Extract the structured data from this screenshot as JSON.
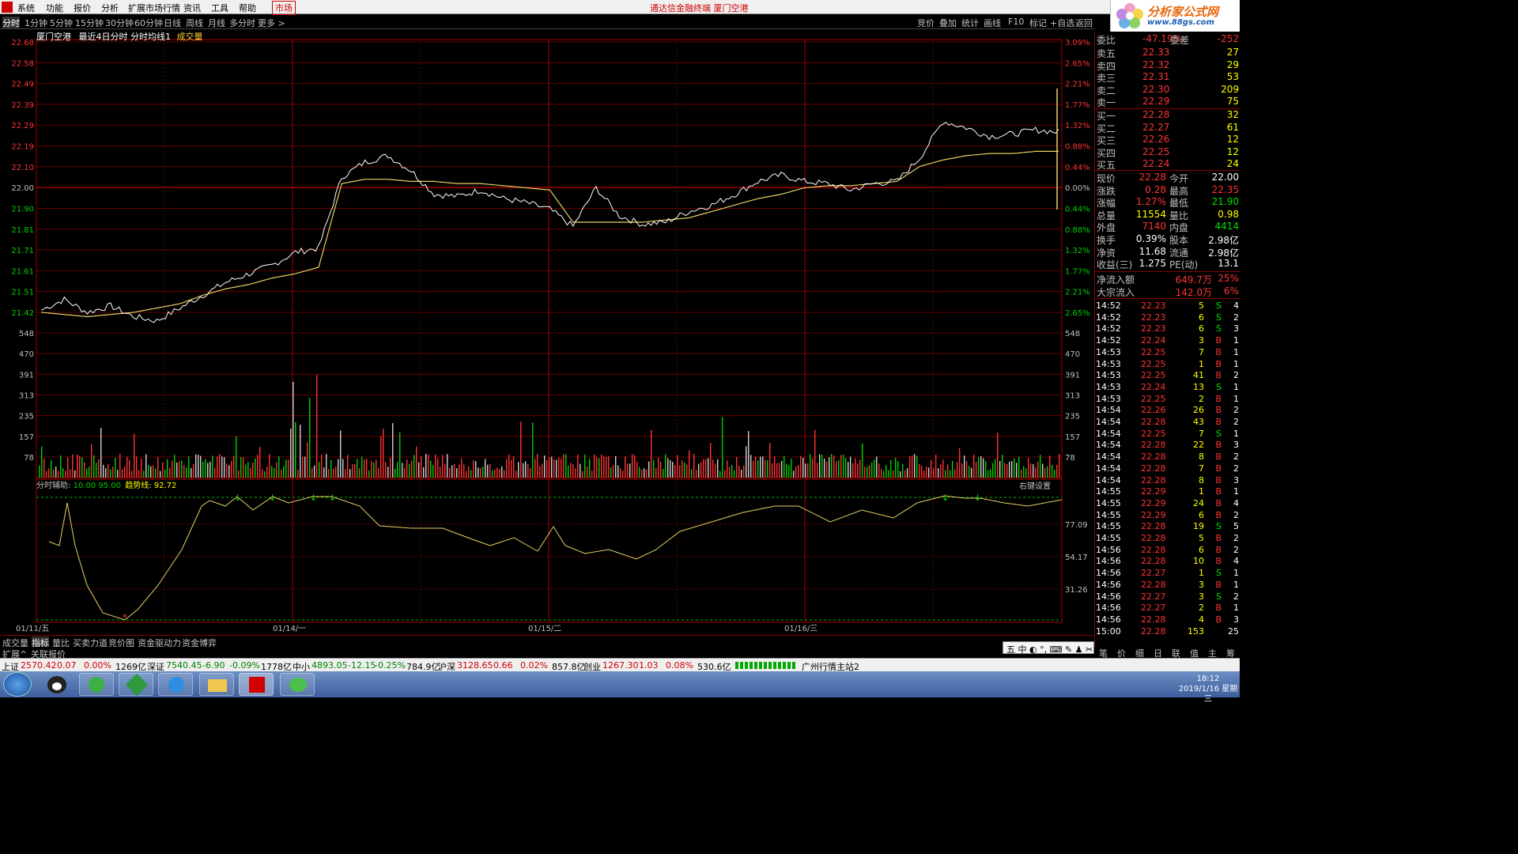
{
  "menubar": {
    "items": [
      "系统",
      "功能",
      "报价",
      "分析",
      "扩展市场行情",
      "资讯",
      "工具",
      "帮助",
      "市场"
    ],
    "title": "通达信金融终端 厦门空港"
  },
  "logo": {
    "text": "分析家公式网",
    "url": "www.88gs.com"
  },
  "toolbar": {
    "left": [
      "分时",
      "1分钟",
      "5分钟",
      "15分钟",
      "30分钟",
      "60分钟",
      "日线",
      "周线",
      "月线",
      "多分时",
      "更多 >"
    ],
    "right": [
      "竞价",
      "叠加",
      "统计",
      "画线",
      "F10",
      "标记",
      "+自选",
      "返回"
    ]
  },
  "chart": {
    "title": "厦门空港",
    "subtitle": "最近4日分时 分时均线1",
    "vol_label": "成交量",
    "price_ticks": [
      "22.68",
      "22.58",
      "22.49",
      "22.39",
      "22.29",
      "22.19",
      "22.10",
      "22.00",
      "21.90",
      "21.81",
      "21.71",
      "21.61",
      "21.51",
      "21.42"
    ],
    "pct_ticks": [
      "3.09%",
      "2.65%",
      "2.21%",
      "1.77%",
      "1.32%",
      "0.88%",
      "0.44%",
      "0.00%",
      "0.44%",
      "0.88%",
      "1.32%",
      "1.77%",
      "2.21%",
      "2.65%"
    ],
    "vol_ticks": [
      "548",
      "470",
      "391",
      "313",
      "235",
      "157",
      "78"
    ],
    "date_labels": [
      "01/11/五",
      "01/14/一",
      "01/15/二",
      "01/16/三"
    ],
    "indicator": {
      "name": "分时辅助",
      "p1": "10.00",
      "p2": "95.00",
      "trend_label": "趋势线:",
      "trend_value": "92.72",
      "settings": "右键设置",
      "ticks": [
        "77.09",
        "54.17",
        "31.26"
      ]
    }
  },
  "chart_data": {
    "type": "line",
    "title": "厦门空港",
    "ylim": [
      21.42,
      22.68
    ],
    "series": [
      {
        "name": "分时",
        "values": [
          21.43,
          21.48,
          21.42,
          21.45,
          21.4,
          21.38,
          21.44,
          21.5,
          21.56,
          21.6,
          21.64,
          21.7,
          21.72,
          22.05,
          22.12,
          22.15,
          22.08,
          21.97,
          21.96,
          21.99,
          21.95,
          21.93,
          21.9,
          21.82,
          22.0,
          21.87,
          21.83,
          21.84,
          21.89,
          21.92,
          21.97,
          22.03,
          22.06,
          22.03,
          22.02,
          21.99,
          22.02,
          22.03,
          22.14,
          22.31,
          22.28,
          22.24,
          22.25,
          22.27,
          22.26
        ]
      },
      {
        "name": "分时均线",
        "values": [
          21.42,
          21.41,
          21.4,
          21.41,
          21.42,
          21.44,
          21.46,
          21.5,
          21.53,
          21.55,
          21.58,
          21.6,
          21.63,
          22.02,
          22.04,
          22.04,
          22.03,
          22.03,
          22.02,
          22.02,
          22.01,
          22.0,
          21.99,
          21.84,
          21.84,
          21.84,
          21.84,
          21.85,
          21.86,
          21.89,
          21.92,
          21.95,
          21.97,
          22.0,
          22.01,
          22.01,
          22.02,
          22.03,
          22.1,
          22.13,
          22.15,
          22.16,
          22.16,
          22.17,
          22.17
        ]
      }
    ]
  },
  "quote": {
    "weibi": {
      "label": "委比",
      "value": "-47.19%",
      "label2": "委差",
      "value2": "-252"
    },
    "asks": [
      {
        "label": "卖五",
        "price": "22.33",
        "vol": "27"
      },
      {
        "label": "卖四",
        "price": "22.32",
        "vol": "29"
      },
      {
        "label": "卖三",
        "price": "22.31",
        "vol": "53"
      },
      {
        "label": "卖二",
        "price": "22.30",
        "vol": "209"
      },
      {
        "label": "卖一",
        "price": "22.29",
        "vol": "75"
      }
    ],
    "bids": [
      {
        "label": "买一",
        "price": "22.28",
        "vol": "32"
      },
      {
        "label": "买二",
        "price": "22.27",
        "vol": "61"
      },
      {
        "label": "买三",
        "price": "22.26",
        "vol": "12"
      },
      {
        "label": "买四",
        "price": "22.25",
        "vol": "12"
      },
      {
        "label": "买五",
        "price": "22.24",
        "vol": "24"
      }
    ],
    "stats": [
      {
        "l1": "现价",
        "v1": "22.28",
        "l2": "今开",
        "v2": "22.00"
      },
      {
        "l1": "涨跌",
        "v1": "0.28",
        "l2": "最高",
        "v2": "22.35"
      },
      {
        "l1": "涨幅",
        "v1": "1.27%",
        "l2": "最低",
        "v2": "21.90"
      },
      {
        "l1": "总量",
        "v1": "11554",
        "l2": "量比",
        "v2": "0.98"
      },
      {
        "l1": "外盘",
        "v1": "7140",
        "l2": "内盘",
        "v2": "4414"
      },
      {
        "l1": "换手",
        "v1": "0.39%",
        "l2": "股本",
        "v2": "2.98亿"
      },
      {
        "l1": "净资",
        "v1": "11.68",
        "l2": "流通",
        "v2": "2.98亿"
      },
      {
        "l1": "收益(三)",
        "v1": "1.275",
        "l2": "PE(动)",
        "v2": "13.1"
      }
    ],
    "flows": [
      {
        "label": "净流入额",
        "value": "649.7万",
        "pct": "25%"
      },
      {
        "label": "大宗流入",
        "value": "142.0万",
        "pct": "6%"
      }
    ]
  },
  "ticks": [
    [
      "14:52",
      "22.23",
      "5",
      "S",
      "4"
    ],
    [
      "14:52",
      "22.23",
      "6",
      "S",
      "2"
    ],
    [
      "14:52",
      "22.23",
      "6",
      "S",
      "3"
    ],
    [
      "14:52",
      "22.24",
      "3",
      "B",
      "1"
    ],
    [
      "14:53",
      "22.25",
      "7",
      "B",
      "1"
    ],
    [
      "14:53",
      "22.25",
      "1",
      "B",
      "1"
    ],
    [
      "14:53",
      "22.25",
      "41",
      "B",
      "2"
    ],
    [
      "14:53",
      "22.24",
      "13",
      "S",
      "1"
    ],
    [
      "14:53",
      "22.25",
      "2",
      "B",
      "1"
    ],
    [
      "14:54",
      "22.26",
      "26",
      "B",
      "2"
    ],
    [
      "14:54",
      "22.28",
      "43",
      "B",
      "2"
    ],
    [
      "14:54",
      "22.25",
      "7",
      "S",
      "1"
    ],
    [
      "14:54",
      "22.28",
      "22",
      "B",
      "3"
    ],
    [
      "14:54",
      "22.28",
      "8",
      "B",
      "2"
    ],
    [
      "14:54",
      "22.28",
      "7",
      "B",
      "2"
    ],
    [
      "14:54",
      "22.28",
      "8",
      "B",
      "3"
    ],
    [
      "14:55",
      "22.29",
      "1",
      "B",
      "1"
    ],
    [
      "14:55",
      "22.29",
      "24",
      "B",
      "4"
    ],
    [
      "14:55",
      "22.29",
      "6",
      "B",
      "2"
    ],
    [
      "14:55",
      "22.28",
      "19",
      "S",
      "5"
    ],
    [
      "14:55",
      "22.28",
      "5",
      "B",
      "2"
    ],
    [
      "14:56",
      "22.28",
      "6",
      "B",
      "2"
    ],
    [
      "14:56",
      "22.28",
      "10",
      "B",
      "4"
    ],
    [
      "14:56",
      "22.27",
      "1",
      "S",
      "1"
    ],
    [
      "14:56",
      "22.28",
      "3",
      "B",
      "1"
    ],
    [
      "14:56",
      "22.27",
      "3",
      "S",
      "2"
    ],
    [
      "14:56",
      "22.27",
      "2",
      "B",
      "1"
    ],
    [
      "14:56",
      "22.28",
      "4",
      "B",
      "3"
    ],
    [
      "15:00",
      "22.28",
      "153",
      "",
      "25"
    ]
  ],
  "bottom_tabs": [
    "成交量",
    "指标",
    "量比",
    "买卖力道",
    "竞价图",
    "资金驱动力",
    "资金博弈"
  ],
  "bottom_tabs2": [
    "扩展^",
    "关联报价"
  ],
  "right_tabs": [
    "笔",
    "价",
    "细",
    "日",
    "联",
    "值",
    "主",
    "筹"
  ],
  "ime": "五 中 ◐ °, ⌨ ✎ ♟ ✂",
  "status": [
    {
      "name": "上证",
      "value": "2570.42",
      "chg": "0.07",
      "pct": "0.00%",
      "amt": "1269亿"
    },
    {
      "name": "深证",
      "value": "7540.45",
      "chg": "-6.90",
      "pct": "-0.09%",
      "amt": "1778亿"
    },
    {
      "name": "中小",
      "value": "4893.05",
      "chg": "-12.15",
      "pct": "-0.25%",
      "amt": "784.9亿"
    },
    {
      "name": "沪深",
      "value": "3128.65",
      "chg": "0.66",
      "pct": "0.02%",
      "amt": "857.8亿"
    },
    {
      "name": "创业",
      "value": "1267.30",
      "chg": "1.03",
      "pct": "0.08%",
      "amt": "530.6亿"
    }
  ],
  "station": "广州行情主站2",
  "clock": {
    "time": "18:12",
    "date": "2019/1/16 星期三"
  }
}
